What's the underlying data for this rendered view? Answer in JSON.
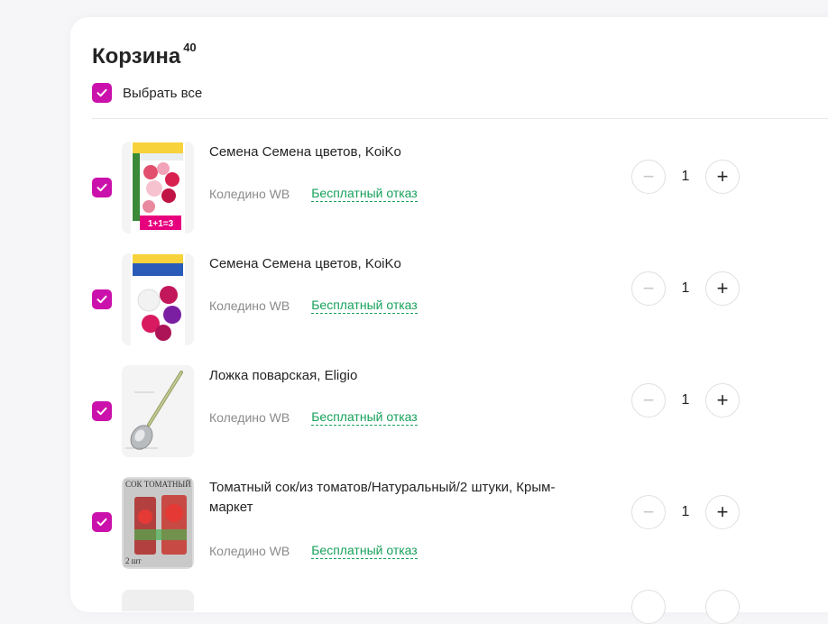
{
  "cart": {
    "title": "Корзина",
    "count": "40",
    "select_all_label": "Выбрать все",
    "accent_color": "#cb11ab",
    "refund_color": "#17a15b"
  },
  "items": [
    {
      "name": "Семена Семена цветов, KoiKo",
      "seller": "Коледино WB",
      "refund": "Бесплатный отказ",
      "quantity": "1",
      "checked": true,
      "image": "flower-seeds-pink",
      "thumb_label": "1+1=3"
    },
    {
      "name": "Семена Семена цветов, KoiKo",
      "seller": "Коледино WB",
      "refund": "Бесплатный отказ",
      "quantity": "1",
      "checked": true,
      "image": "flower-seeds-mixed"
    },
    {
      "name": "Ложка поварская, Eligio",
      "seller": "Коледино WB",
      "refund": "Бесплатный отказ",
      "quantity": "1",
      "checked": true,
      "image": "cooking-spoon"
    },
    {
      "name": "Томатный сок/из томатов/Натуральный/2 штуки, Крым-маркет",
      "seller": "Коледино WB",
      "refund": "Бесплатный отказ",
      "quantity": "1",
      "checked": true,
      "image": "tomato-juice",
      "thumb_label_top": "СОК ТОМАТНЫЙ",
      "thumb_label_bottom": "2 шт"
    }
  ],
  "icons": {
    "checkbox": "checkmark-icon",
    "minus": "minus-icon",
    "plus": "plus-icon"
  },
  "labels": {
    "minus": "−",
    "plus": "+"
  }
}
